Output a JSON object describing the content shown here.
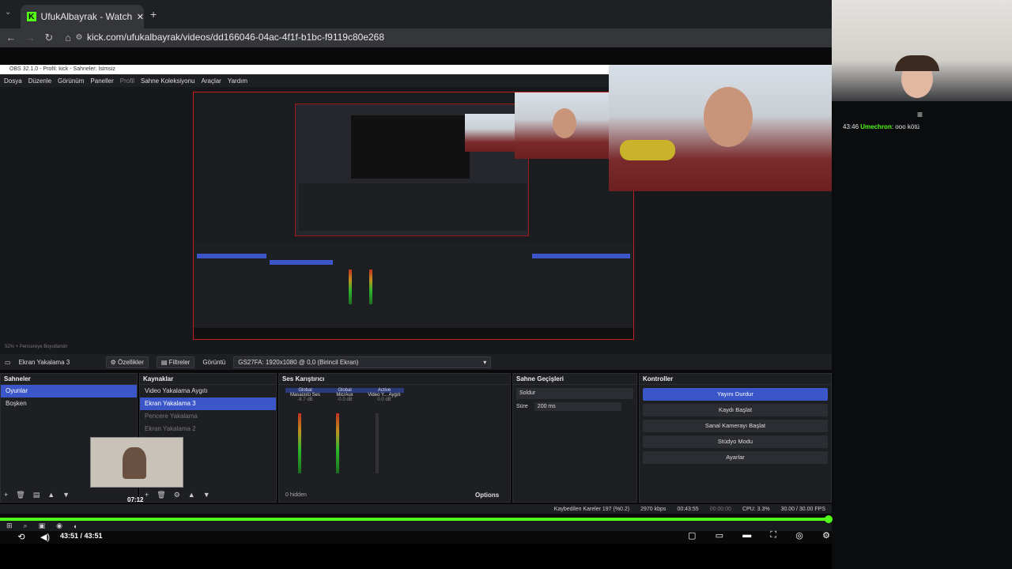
{
  "browser": {
    "tab_title": "UfukAlbayrak - Watch the VOD",
    "url": "kick.com/ufukalbayrak/videos/dd166046-04ac-4f1f-b1bc-f9119c80e268"
  },
  "obs": {
    "window_title": "OBS 32.1.0 - Profil: kick - Sahneler: İsimsiz",
    "menu": [
      "Dosya",
      "Düzenle",
      "Görünüm",
      "Paneller",
      "Profil",
      "Sahne Koleksiyonu",
      "Araçlar",
      "Yardım"
    ],
    "source_bar": {
      "source": "Ekran Yakalama 3",
      "properties": "Özellikler",
      "filters": "Filtreler",
      "display_label": "Görüntü",
      "display_value": "GS27FA: 1920x1080 @ 0,0 (Birincil Ekran)"
    },
    "scenes": {
      "title": "Sahneler",
      "items": [
        "Oyunlar",
        "Boşken"
      ]
    },
    "sources": {
      "title": "Kaynaklar",
      "items": [
        "Video Yakalama Aygıtı",
        "Ekran Yakalama 3",
        "Pencere Yakalama",
        "Ekran Yakalama 2"
      ]
    },
    "mixer": {
      "title": "Ses Karıştırıcı",
      "channels": [
        {
          "name": "Masaüstü Ses",
          "tag": "Global",
          "db": "-8.7 dB"
        },
        {
          "name": "Mic/Aux",
          "tag": "Global",
          "db": "-0.0 dB"
        },
        {
          "name": "Video Y... Aygıtı",
          "tag": "Active",
          "db": "0.0 dB"
        }
      ],
      "hidden": "0 hidden",
      "options": "Options"
    },
    "transitions": {
      "title": "Sahne Geçişleri",
      "type": "Soldur",
      "duration_label": "Süre",
      "duration": "200 ms"
    },
    "controls": {
      "title": "Kontroller",
      "buttons": [
        "Yayını Durdur",
        "Kaydı Başlat",
        "Sanal Kamerayı Başlat",
        "Stüdyo Modu",
        "Ayarlar"
      ]
    },
    "status": {
      "dropped": "Kaybedilen Kareler 197 (%0.2)",
      "bitrate": "2970 kbps",
      "live_time": "00:43:55",
      "rec_time": "00:00:00",
      "cpu": "CPU: 3.3%",
      "fps": "30.00 / 30.00 FPS"
    }
  },
  "chat": {
    "time": "43:46",
    "user": "Umechron",
    "message": "ooo kötü"
  },
  "player": {
    "time": "43:51 / 43:51",
    "pip_time": "07:12",
    "progress": 1.0
  },
  "accent": "#53fc18"
}
